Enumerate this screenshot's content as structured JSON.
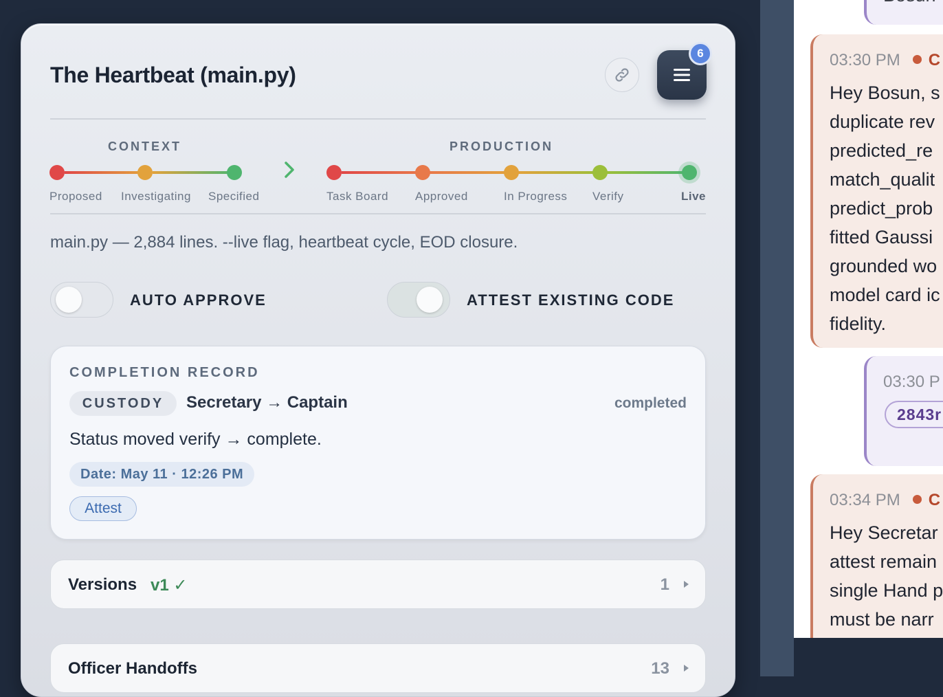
{
  "panel": {
    "title": "The Heartbeat (main.py)",
    "menu_badge_count": "6",
    "summary": "main.py — 2,884 lines. --live flag, heartbeat cycle, EOD closure."
  },
  "pipeline": {
    "context_label": "CONTEXT",
    "production_label": "PRODUCTION",
    "steps": [
      {
        "label": "Proposed",
        "color": "#e04848"
      },
      {
        "label": "Investigating",
        "color": "#e2a23c"
      },
      {
        "label": "Specified",
        "color": "#4fb56e"
      },
      {
        "label": "Task Board",
        "color": "#e04848"
      },
      {
        "label": "Approved",
        "color": "#e8794a"
      },
      {
        "label": "In Progress",
        "color": "#e2a23c"
      },
      {
        "label": "Verify",
        "color": "#9cbf3a"
      },
      {
        "label": "Live",
        "color": "#4fb56e"
      }
    ],
    "active_step": "Live"
  },
  "toggles": {
    "auto_approve": {
      "label": "AUTO APPROVE",
      "on": false
    },
    "attest_existing": {
      "label": "ATTEST EXISTING CODE",
      "on": true
    }
  },
  "completion_record": {
    "heading": "COMPLETION RECORD",
    "custody_label": "CUSTODY",
    "custody_route": "Secretary → Captain",
    "custody_state": "completed",
    "status_text": "Status moved verify → complete.",
    "date_label": "Date: May 11 · 12:26 PM",
    "attest_label": "Attest"
  },
  "sections": [
    {
      "title": "Versions",
      "version": "v1 ✓",
      "count": "1"
    },
    {
      "title": "Officer Handoffs",
      "version": "",
      "count": "13"
    }
  ],
  "chat": {
    "top_fragment": "Bosun",
    "messages": [
      {
        "time": "03:30 PM",
        "sender": "C",
        "lines": [
          "Hey Bosun, s",
          "duplicate rev",
          "predicted_re",
          "match_qualit",
          "predict_prob",
          "fitted Gaussi",
          "grounded wo",
          "model card ic",
          "fidelity."
        ]
      },
      {
        "time": "03:30 P",
        "tag": "2843r"
      },
      {
        "time": "03:34 PM",
        "sender": "C",
        "lines": [
          "Hey Secretar",
          "attest remain",
          "single Hand p",
          "must be narr"
        ]
      }
    ]
  },
  "colors": {
    "accent_blue": "#5b86e0",
    "success_green": "#3d8a58",
    "menu_dark": "#2a3547"
  }
}
